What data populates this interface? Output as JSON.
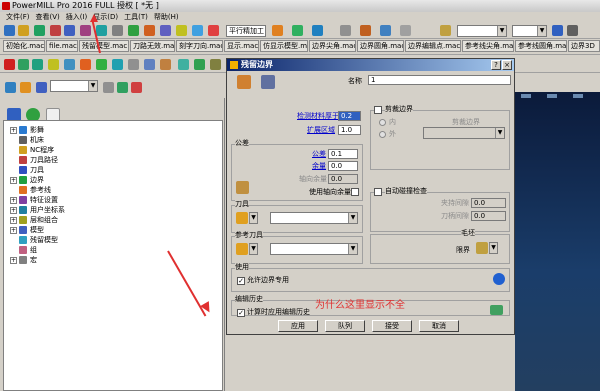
{
  "window": {
    "title": "PowerMILL Pro 2016 FULL 授权   [  *无  ]"
  },
  "menu": [
    "文件(F)",
    "查看(V)",
    "插入(I)",
    "显示(D)",
    "工具(T)",
    "帮助(H)"
  ],
  "toolbar2": {
    "tool_label": "平行精加工"
  },
  "macro_tabs": [
    "初始化.mac",
    "file.mac",
    "残留模型.mac",
    "刀路无效.mac",
    "刻字刀向.mac",
    "显示.mac",
    "仿显示模型.mac",
    "边界尖角.mac",
    "边界圆角.mac",
    "边界编辑点.mac",
    "参考线尖角.mac",
    "参考线圆角.mac",
    "边界3D"
  ],
  "dialog": {
    "title": "残留边界",
    "name_label": "名称",
    "name_value": "1",
    "detect_thickness_label": "检测材料厚于",
    "detect_thickness_value": "0.2",
    "expand_area_label": "扩展区域",
    "expand_area_value": "1.0",
    "tolerance_group": "公差",
    "tolerance_label": "公差",
    "tolerance_value": "0.1",
    "allowance_label": "余量",
    "allowance_value": "0.0",
    "axial_allowance_label": "轴向余量",
    "axial_allowance_value": "0.0",
    "use_axial_label": "使用轴向余量",
    "trim_group": "剪裁边界",
    "inner_label": "内",
    "outer_label": "外",
    "trim_boundary_label": "剪裁边界",
    "tool_group": "刀具",
    "ref_tool_group": "参考刀具",
    "auto_collision_label": "自动碰撞检查",
    "holder_clearance_label": "夹持间隙",
    "holder_clearance_value": "0.0",
    "shank_clearance_label": "刀柄间隙",
    "shank_clearance_value": "0.0",
    "stock_group": "毛坯",
    "boundary_label": "限界",
    "use_group": "使用",
    "allow_boundary_label": "允许边界专用",
    "edit_history_group": "编辑历史",
    "apply_history_label": "计算时应用编辑历史",
    "annotation_text": "为什么这里显示不全",
    "buttons": {
      "apply": "应用",
      "queue": "队列",
      "accept": "接受",
      "cancel": "取消"
    }
  },
  "tree": {
    "items": [
      {
        "label": "影舞",
        "pm": "+",
        "color": "#2a7ad0"
      },
      {
        "label": "机床",
        "pm": "",
        "color": "#606060"
      },
      {
        "label": "NC程序",
        "pm": "",
        "color": "#d0a020"
      },
      {
        "label": "刀具路径",
        "pm": "",
        "color": "#c04040"
      },
      {
        "label": "刀具",
        "pm": "",
        "color": "#3050c0"
      },
      {
        "label": "边界",
        "pm": "+",
        "color": "#20a040"
      },
      {
        "label": "参考线",
        "pm": "",
        "color": "#e07020"
      },
      {
        "label": "特征设置",
        "pm": "+",
        "color": "#8040a0"
      },
      {
        "label": "用户坐标系",
        "pm": "+",
        "color": "#2080a0"
      },
      {
        "label": "层和组合",
        "pm": "+",
        "color": "#a0a020"
      },
      {
        "label": "模型",
        "pm": "+",
        "color": "#4060c0"
      },
      {
        "label": "残留模型",
        "pm": "",
        "color": "#30a0c0"
      },
      {
        "label": "组",
        "pm": "",
        "color": "#c06080"
      },
      {
        "label": "宏",
        "pm": "+",
        "color": "#808080"
      }
    ]
  },
  "colors": {
    "title_bar": "#0a246a",
    "annotation": "#e03030",
    "viewport": "#1a3d6a"
  }
}
